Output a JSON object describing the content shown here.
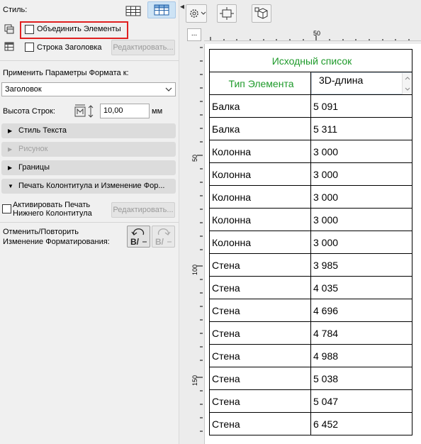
{
  "left": {
    "style_label": "Стиль:",
    "merge_label": "Объединить Элементы",
    "header_row_label": "Строка Заголовка",
    "edit_label": "Редактировать...",
    "apply_format_label": "Применить Параметры Формата к:",
    "apply_format_value": "Заголовок",
    "row_height_label": "Высота Строк:",
    "row_height_value": "10,00",
    "row_height_unit": "мм",
    "sections": [
      {
        "label": "Стиль Текста"
      },
      {
        "label": "Рисунок"
      },
      {
        "label": "Границы"
      },
      {
        "label": "Печать Колонтитула и Изменение Фор..."
      }
    ],
    "footer_activate_label_1": "Активировать Печать",
    "footer_activate_label_2": "Нижнего Колонтитула",
    "footer_edit_label": "Редактировать...",
    "undo_label_1": "Отменить/Повторить",
    "undo_label_2": "Изменение Форматирования:"
  },
  "ruler": {
    "h_marks": [
      "50"
    ],
    "v_marks": [
      "50",
      "100",
      "150"
    ]
  },
  "table": {
    "title": "Исходный список",
    "col1_header": "Тип Элемента",
    "col2_header": "3D-длина",
    "rows": [
      {
        "type": "Балка",
        "length": "5 091"
      },
      {
        "type": "Балка",
        "length": "5 311"
      },
      {
        "type": "Колонна",
        "length": "3 000"
      },
      {
        "type": "Колонна",
        "length": "3 000"
      },
      {
        "type": "Колонна",
        "length": "3 000"
      },
      {
        "type": "Колонна",
        "length": "3 000"
      },
      {
        "type": "Колонна",
        "length": "3 000"
      },
      {
        "type": "Стена",
        "length": "3 985"
      },
      {
        "type": "Стена",
        "length": "4 035"
      },
      {
        "type": "Стена",
        "length": "4 696"
      },
      {
        "type": "Стена",
        "length": "4 784"
      },
      {
        "type": "Стена",
        "length": "4 988"
      },
      {
        "type": "Стена",
        "length": "5 038"
      },
      {
        "type": "Стена",
        "length": "5 047"
      },
      {
        "type": "Стена",
        "length": "6 452"
      }
    ]
  },
  "colors": {
    "accent_green": "#1e9a2a",
    "highlight_red": "#e02020",
    "selected_style": "#cde3f5"
  }
}
